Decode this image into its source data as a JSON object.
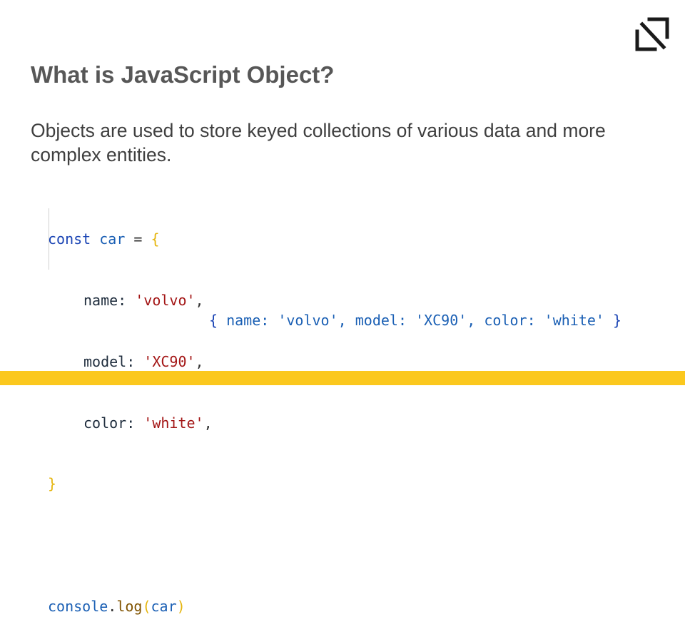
{
  "slide": {
    "title": "What is JavaScript Object?",
    "description": "Objects are used to store keyed collections of various data and more complex entities.",
    "logo_icon": "n-corner-logo-icon",
    "accent_color": "#fbc81e"
  },
  "code": {
    "line1": {
      "kw": "const",
      "var": "car",
      "eq": " = ",
      "open": "{"
    },
    "props": [
      {
        "key": "name: ",
        "value": "'volvo'",
        "comma": ","
      },
      {
        "key": "model: ",
        "value": "'XC90'",
        "comma": ","
      },
      {
        "key": "color: ",
        "value": "'white'",
        "comma": ","
      }
    ],
    "close": "}",
    "log": {
      "obj": "console",
      "dot": ".",
      "fn": "log",
      "lp": "(",
      "arg": "car",
      "rp": ")"
    }
  },
  "output": {
    "text_open": "{ ",
    "entries": [
      {
        "key": "name: ",
        "value": "'volvo'",
        "sep": ", "
      },
      {
        "key": "model: ",
        "value": "'XC90'",
        "sep": ", "
      },
      {
        "key": "color: ",
        "value": "'white'",
        "sep": " "
      }
    ],
    "text_close": "}"
  }
}
